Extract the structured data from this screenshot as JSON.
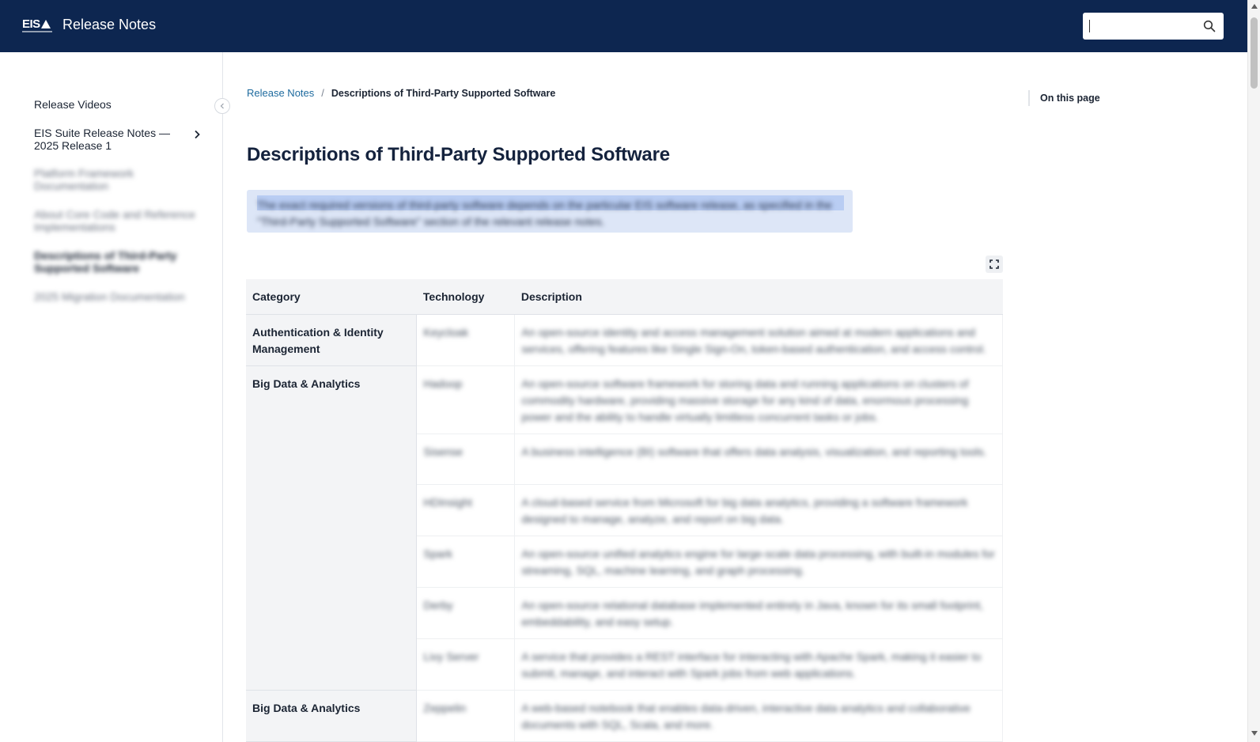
{
  "header": {
    "logo_text": "EIS",
    "title": "Release Notes",
    "search": {
      "value": "",
      "placeholder": "",
      "icon": "search-icon"
    }
  },
  "sidebar": {
    "items": [
      {
        "label": "Release Videos",
        "state": "normal"
      },
      {
        "label": "EIS Suite Release Notes — 2025 Release 1",
        "state": "normal",
        "has_children": true
      },
      {
        "label": "Platform Framework Documentation",
        "state": "blurred"
      },
      {
        "label": "About Core Code and Reference Implementations",
        "state": "blurred"
      },
      {
        "label": "Descriptions of Third-Party Supported Software",
        "state": "active"
      },
      {
        "label": "2025 Migration Documentation",
        "state": "blurred"
      }
    ]
  },
  "breadcrumb": {
    "root": "Release Notes",
    "separator": "/",
    "current": "Descriptions of Third-Party Supported Software"
  },
  "main": {
    "title": "Descriptions of Third-Party Supported Software",
    "note": "The exact required versions of third-party software depends on the particular EIS software release, as specified in the \"Third-Party Supported Software\" section of the relevant release notes."
  },
  "toc": {
    "label": "On this page"
  },
  "table": {
    "headers": [
      "Category",
      "Technology",
      "Description"
    ],
    "groups": [
      {
        "category": "Authentication & Identity Management",
        "rows": [
          {
            "technology": "Keycloak",
            "description": "An open-source identity and access management solution aimed at modern applications and services, offering features like Single Sign-On, token-based authentication, and access control."
          }
        ]
      },
      {
        "category": "Big Data & Analytics",
        "rows": [
          {
            "technology": "Hadoop",
            "description": "An open-source software framework for storing data and running applications on clusters of commodity hardware, providing massive storage for any kind of data, enormous processing power and the ability to handle virtually limitless concurrent tasks or jobs."
          },
          {
            "technology": "Sisense",
            "description": "A business intelligence (BI) software that offers data analysis, visualization, and reporting tools."
          },
          {
            "technology": "HDInsight",
            "description": "A cloud-based service from Microsoft for big data analytics, providing a software framework designed to manage, analyze, and report on big data."
          },
          {
            "technology": "Spark",
            "description": "An open-source unified analytics engine for large-scale data processing, with built-in modules for streaming, SQL, machine learning, and graph processing."
          },
          {
            "technology": "Derby",
            "description": "An open-source relational database implemented entirely in Java, known for its small footprint, embeddability, and easy setup."
          },
          {
            "technology": "Livy Server",
            "description": "A service that provides a REST interface for interacting with Apache Spark, making it easier to submit, manage, and interact with Spark jobs from web applications."
          }
        ]
      },
      {
        "category": "Big Data & Analytics",
        "rows": [
          {
            "technology": "Zeppelin",
            "description": "A web-based notebook that enables data-driven, interactive data analytics and collaborative documents with SQL, Scala, and more."
          }
        ]
      }
    ]
  },
  "colors": {
    "header_bg": "#0d2650",
    "link": "#1d6a9e",
    "note_bg": "#dde6f7",
    "table_header_bg": "#f3f4f6"
  }
}
